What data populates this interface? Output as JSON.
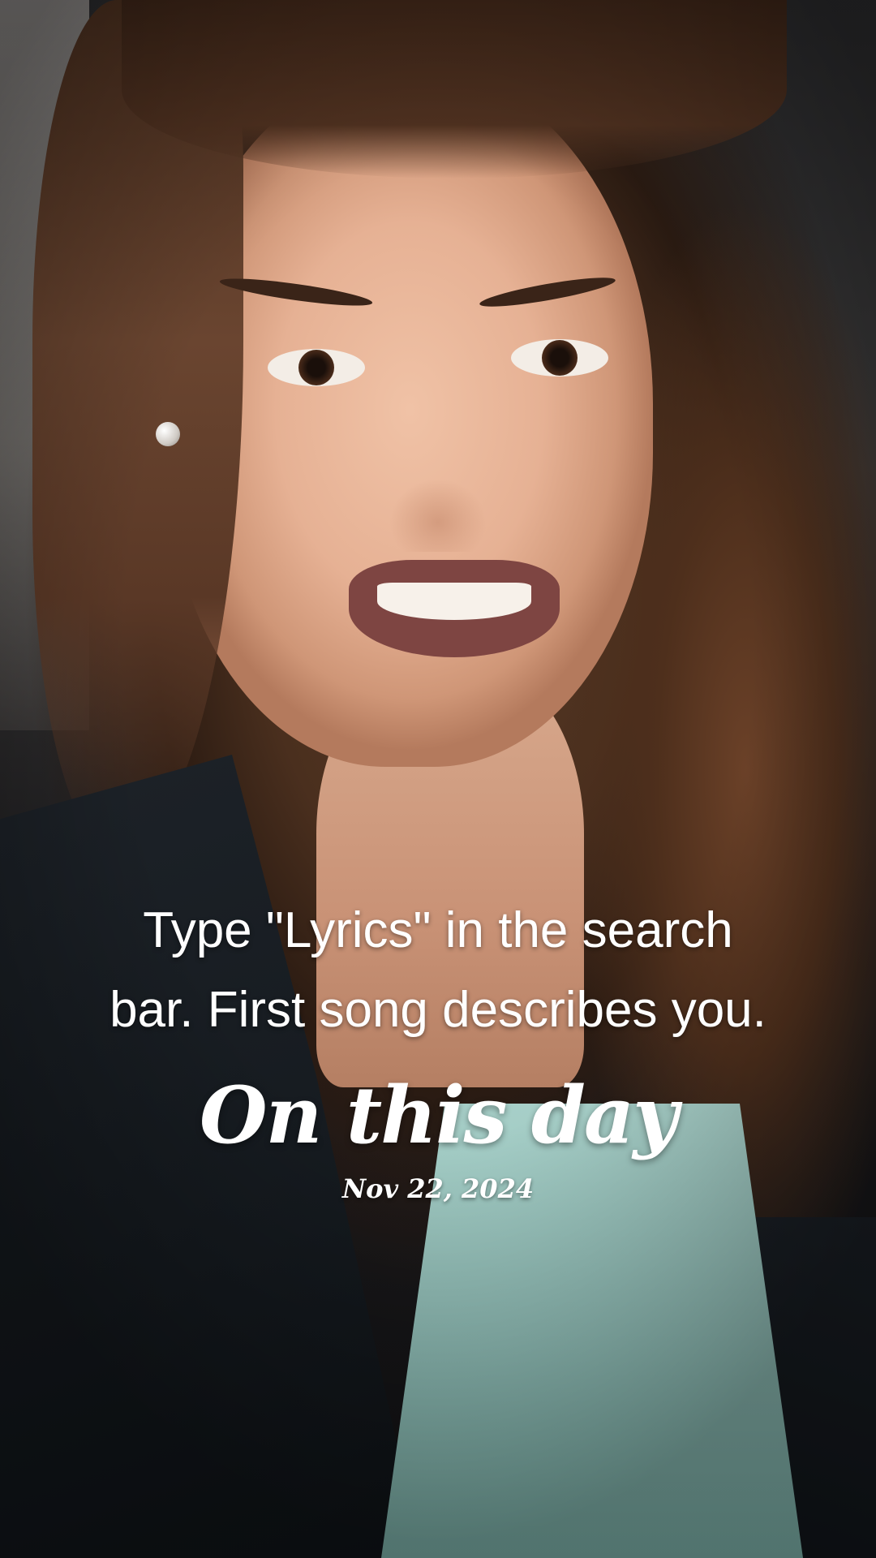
{
  "caption": {
    "line1": "Type \"Lyrics\" in the search",
    "line2": "bar. First song describes you."
  },
  "memory": {
    "title": "On this day",
    "date": "Nov 22, 2024"
  }
}
